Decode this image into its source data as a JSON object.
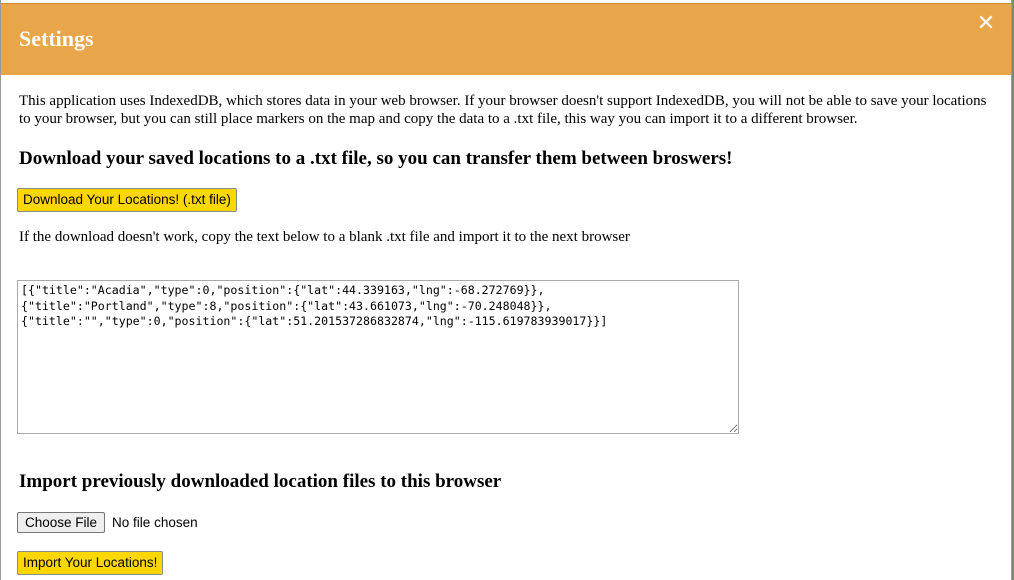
{
  "header": {
    "title": "Settings",
    "close_icon": "✕",
    "background_color": "#e8a54a"
  },
  "intro_text": "This application uses IndexedDB, which stores data in your web browser. If your browser doesn't support IndexedDB, you will not be able to save your locations to your browser, but you can still place markers on the map and copy the data to a .txt file, this way you can import it to a different browser.",
  "download_section": {
    "heading": "Download your saved locations to a .txt file, so you can transfer them between broswers!",
    "button_label": "Download Your Locations! (.txt file)",
    "fallback_note": "If the download doesn't work, copy the text below to a blank .txt file and import it to the next browser",
    "textarea_value": "[{\"title\":\"Acadia\",\"type\":0,\"position\":{\"lat\":44.339163,\"lng\":-68.272769}},\n{\"title\":\"Portland\",\"type\":8,\"position\":{\"lat\":43.661073,\"lng\":-70.248048}},\n{\"title\":\"\",\"type\":0,\"position\":{\"lat\":51.201537286832874,\"lng\":-115.619783939017}}]"
  },
  "import_section": {
    "heading": "Import previously downloaded location files to this browser",
    "choose_file_label": "Choose File",
    "file_status": "No file chosen",
    "import_button_label": "Import Your Locations!"
  },
  "colors": {
    "accent_button": "#ffd700"
  }
}
